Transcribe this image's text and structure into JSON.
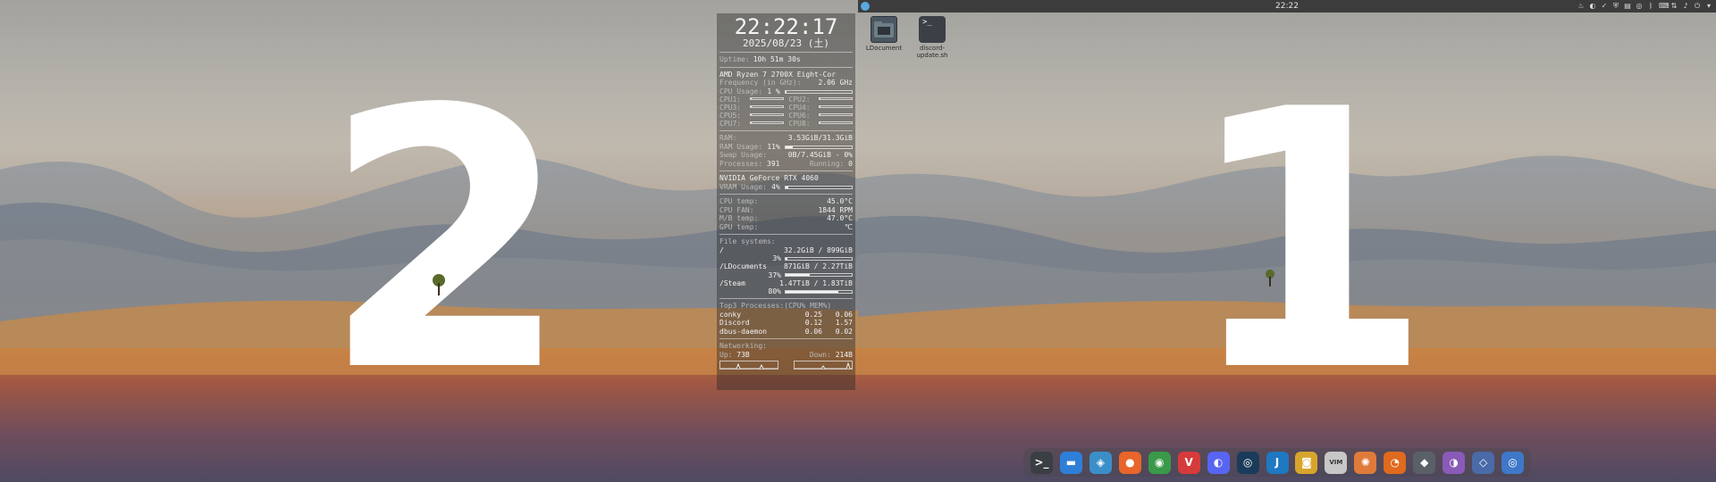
{
  "monitors": {
    "left": {
      "number": "2"
    },
    "right": {
      "number": "1"
    }
  },
  "conky": {
    "time": "22:22:17",
    "date": "2025/08/23 (土)",
    "uptime_label": "Uptime:",
    "uptime_value": "10h 51m 30s",
    "cpu_model": "AMD Ryzen 7 2700X Eight-Cor",
    "frequency_label": "Frequency (in GHz):",
    "frequency_value": "2.06 GHz",
    "cpu_usage_label": "CPU Usage:",
    "cpu_usage_value": "1 %",
    "cores": [
      {
        "label": "CPU1:",
        "fill": 0.02
      },
      {
        "label": "CPU2:",
        "fill": 0.02
      },
      {
        "label": "CPU3:",
        "fill": 0.02
      },
      {
        "label": "CPU4:",
        "fill": 0.02
      },
      {
        "label": "CPU5:",
        "fill": 0.02
      },
      {
        "label": "CPU6:",
        "fill": 0.02
      },
      {
        "label": "CPU7:",
        "fill": 0.02
      },
      {
        "label": "CPU8:",
        "fill": 0.02
      }
    ],
    "ram_label": "RAM:",
    "ram_value": "3.53GiB/31.3GiB",
    "ram_usage_label": "RAM Usage:",
    "ram_usage_value": "11%",
    "ram_fill": 0.11,
    "swap_label": "Swap Usage:",
    "swap_value": "0B/7.45GiB - 0%",
    "processes_label": "Processes:",
    "processes_value": "391",
    "running_label": "Running:",
    "running_value": "0",
    "gpu_model": "NVIDIA GeForce RTX 4060",
    "vram_label": "VRAM Usage:",
    "vram_value": "4%",
    "vram_fill": 0.04,
    "cpu_temp_label": "CPU temp:",
    "cpu_temp_value": "45.0°C",
    "cpu_fan_label": "CPU FAN:",
    "cpu_fan_value": "1844 RPM",
    "mb_temp_label": "M/B temp:",
    "mb_temp_value": "47.0°C",
    "gpu_temp_label": "GPU temp:",
    "gpu_temp_value": "℃",
    "fs_label": "File systems:",
    "filesystems": [
      {
        "mount": "/",
        "usage": "32.2GiB / 899GiB",
        "percent": "3%",
        "fill": 0.03
      },
      {
        "mount": "/LDocuments",
        "usage": "871GiB / 2.27TiB",
        "percent": "37%",
        "fill": 0.37
      },
      {
        "mount": "/Steam",
        "usage": "1.47TiB / 1.83TiB",
        "percent": "80%",
        "fill": 0.8
      }
    ],
    "top_label": "Top3 Processes:(CPU% MEM%)",
    "processes": [
      {
        "name": "conky",
        "cpu": "0.25",
        "mem": "0.06"
      },
      {
        "name": "Discord",
        "cpu": "0.12",
        "mem": "1.57"
      },
      {
        "name": "dbus-daemon",
        "cpu": "0.06",
        "mem": "0.02"
      }
    ],
    "net_label": "Networking:",
    "up_label": "Up:",
    "up_value": "73B",
    "down_label": "Down:",
    "down_value": "214B"
  },
  "top_panel": {
    "clock": "22:22",
    "tray_icons": [
      "flame-icon",
      "discord-icon",
      "check-icon",
      "shield-icon",
      "clipboard-icon",
      "steam-icon",
      "bluetooth-icon",
      "keyboard-icon",
      "network-icon",
      "volume-icon",
      "power-icon",
      "menu-icon"
    ]
  },
  "desktop_icons": [
    {
      "label": "LDocument",
      "icon": "folder-icon"
    },
    {
      "label": "discord-update.sh",
      "icon": "terminal-script-icon"
    }
  ],
  "dock": {
    "apps": [
      {
        "name": "terminal",
        "glyph": ">_",
        "color": "#3a3f44"
      },
      {
        "name": "files",
        "glyph": "▬",
        "color": "#2f7fd8"
      },
      {
        "name": "software-store",
        "glyph": "◈",
        "color": "#3b8fc9"
      },
      {
        "name": "firefox",
        "glyph": "●",
        "color": "#e8652b"
      },
      {
        "name": "chrome",
        "glyph": "◉",
        "color": "#3a9a4a"
      },
      {
        "name": "vivaldi",
        "glyph": "V",
        "color": "#d63b3b"
      },
      {
        "name": "discord",
        "glyph": "◐",
        "color": "#5865f2"
      },
      {
        "name": "steam",
        "glyph": "◎",
        "color": "#1b3b5a"
      },
      {
        "name": "joplin",
        "glyph": "J",
        "color": "#1e78c2"
      },
      {
        "name": "camera",
        "glyph": "◙",
        "color": "#d8a52c"
      },
      {
        "name": "vim",
        "glyph": "VIM",
        "color": "#c7c7c7"
      },
      {
        "name": "color-picker",
        "glyph": "✺",
        "color": "#e07a3a"
      },
      {
        "name": "blender",
        "glyph": "◔",
        "color": "#e06a1d"
      },
      {
        "name": "settings",
        "glyph": "◆",
        "color": "#5a6068"
      },
      {
        "name": "obs",
        "glyph": "◑",
        "color": "#8a5ab8"
      },
      {
        "name": "kdenlive",
        "glyph": "◇",
        "color": "#4a6aa8"
      },
      {
        "name": "system-monitor",
        "glyph": "◎",
        "color": "#3f78c8"
      }
    ]
  }
}
